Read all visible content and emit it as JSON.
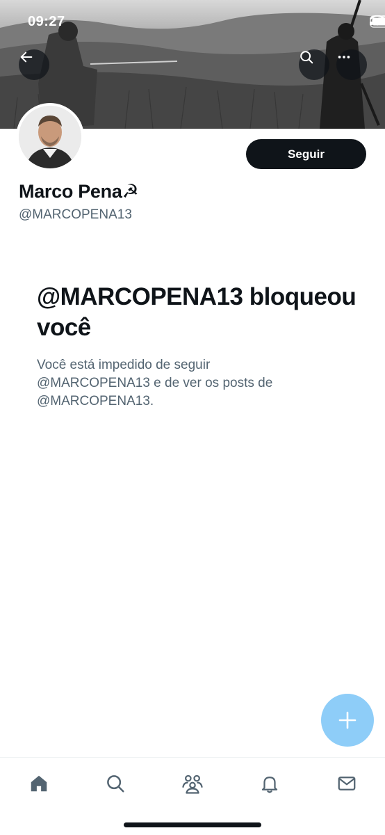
{
  "status_bar": {
    "time": "09:27"
  },
  "profile": {
    "display_name": "Marco Pena☭",
    "handle": "@MARCOPENA13",
    "follow_label": "Seguir"
  },
  "blocked": {
    "title": "@MARCOPENA13 bloqueou você",
    "description": "Você está impedido de seguir @MARCOPENA13 e de ver os posts de @MARCOPENA13."
  },
  "icons": {
    "back": "arrow-left-icon",
    "search": "search-icon",
    "more": "more-horizontal-icon",
    "compose": "plus-icon",
    "tabs": [
      "home-icon",
      "search-icon",
      "communities-icon",
      "notifications-icon",
      "messages-icon"
    ]
  },
  "colors": {
    "primary_button": "#0f1419",
    "secondary_text": "#536471",
    "fab": "#8ecdf8",
    "tab_active": "#536471"
  }
}
